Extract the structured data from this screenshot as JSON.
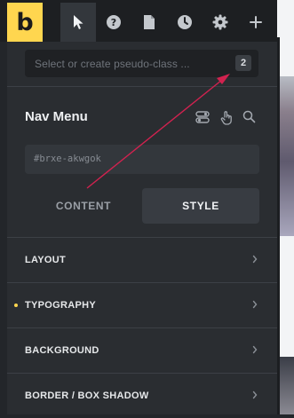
{
  "toolbar": {
    "logo_text": "b",
    "tools": [
      {
        "icon": "cursor-icon",
        "active": true
      },
      {
        "icon": "help-icon",
        "active": false
      },
      {
        "icon": "page-icon",
        "active": false
      },
      {
        "icon": "history-icon",
        "active": false
      },
      {
        "icon": "settings-icon",
        "active": false
      },
      {
        "icon": "add-icon",
        "active": false
      }
    ]
  },
  "pseudo_selector": {
    "placeholder": "Select or create pseudo-class ...",
    "count": "2"
  },
  "element": {
    "title": "Nav Menu",
    "id_placeholder": "#brxe-akwgok"
  },
  "tabs": {
    "content": "CONTENT",
    "style": "STYLE"
  },
  "sections": [
    {
      "label": "LAYOUT",
      "has_dot": false
    },
    {
      "label": "TYPOGRAPHY",
      "has_dot": true
    },
    {
      "label": "BACKGROUND",
      "has_dot": false
    },
    {
      "label": "BORDER / BOX SHADOW",
      "has_dot": false
    }
  ],
  "colors": {
    "accent": "#ffd64f",
    "annotation_arrow": "#d1224f"
  }
}
